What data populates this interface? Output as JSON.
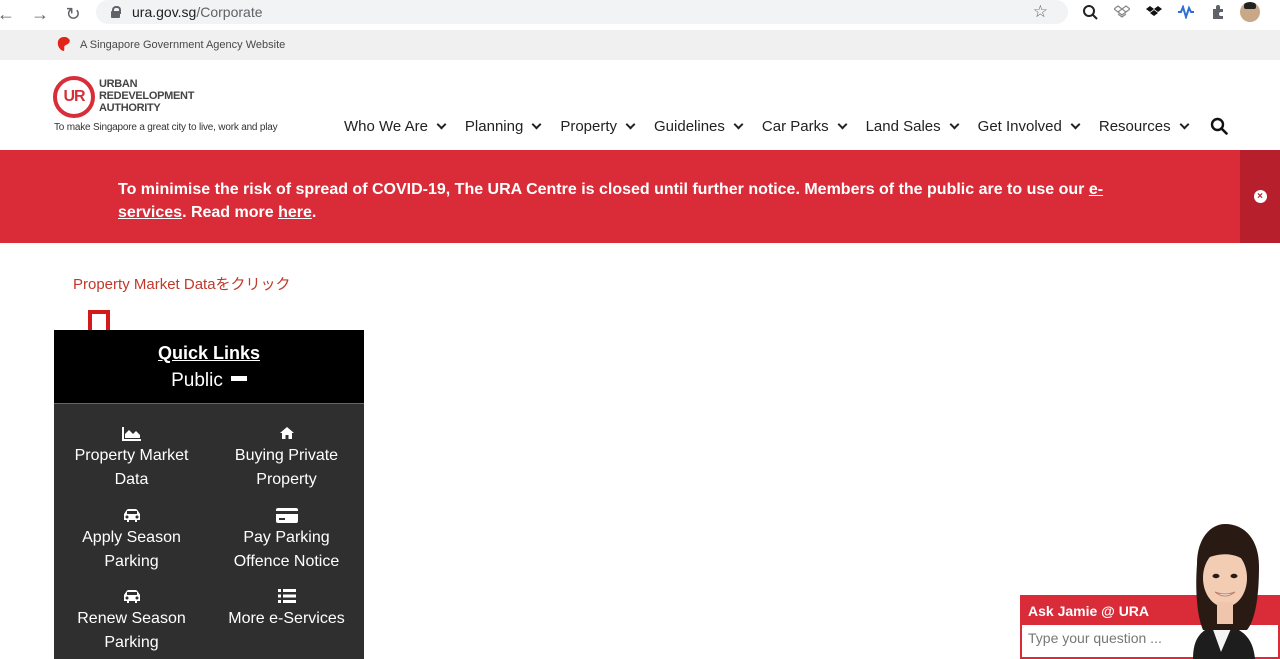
{
  "browser": {
    "url_host": "ura.gov.sg",
    "url_path": "/Corporate"
  },
  "gov_banner": {
    "text": "A Singapore Government Agency Website"
  },
  "logo": {
    "mark": "UR",
    "words": [
      "URBAN",
      "REDEVELOPMENT",
      "AUTHORITY"
    ],
    "tagline": "To make Singapore a great city to live, work and play"
  },
  "nav": {
    "items": [
      {
        "label": "Who We Are"
      },
      {
        "label": "Planning"
      },
      {
        "label": "Property"
      },
      {
        "label": "Guidelines"
      },
      {
        "label": "Car Parks"
      },
      {
        "label": "Land Sales"
      },
      {
        "label": "Get Involved"
      },
      {
        "label": "Resources"
      }
    ]
  },
  "covid_notice": {
    "text_part1": "To minimise the risk of spread of COVID-19, The URA Centre is closed until further notice. Members of the public are to use our ",
    "link1": "e-services",
    "text_part2": ". Read more ",
    "link2": "here",
    "text_part3": "."
  },
  "annotation": {
    "text": "Property Market Dataをクリック",
    "color": "#c0392b"
  },
  "quick_links": {
    "title": "Quick Links",
    "section": "Public",
    "items": [
      {
        "line1": "Property Market",
        "line2": "Data",
        "icon": "area-chart-icon"
      },
      {
        "line1": "Buying Private",
        "line2": "Property",
        "icon": "home-icon"
      },
      {
        "line1": "Apply Season",
        "line2": "Parking",
        "icon": "car-icon"
      },
      {
        "line1": "Pay Parking",
        "line2": "Offence Notice",
        "icon": "credit-card-icon"
      },
      {
        "line1": "Renew Season",
        "line2": "Parking",
        "icon": "car-icon"
      },
      {
        "line1": "More e-Services",
        "line2": "",
        "icon": "list-icon"
      }
    ]
  },
  "chat": {
    "title": "Ask Jamie @ URA",
    "placeholder": "Type your question ..."
  },
  "colors": {
    "brand_red": "#d92b38",
    "quick_links_bg": "#2f2f2f",
    "header_black": "#000000"
  }
}
